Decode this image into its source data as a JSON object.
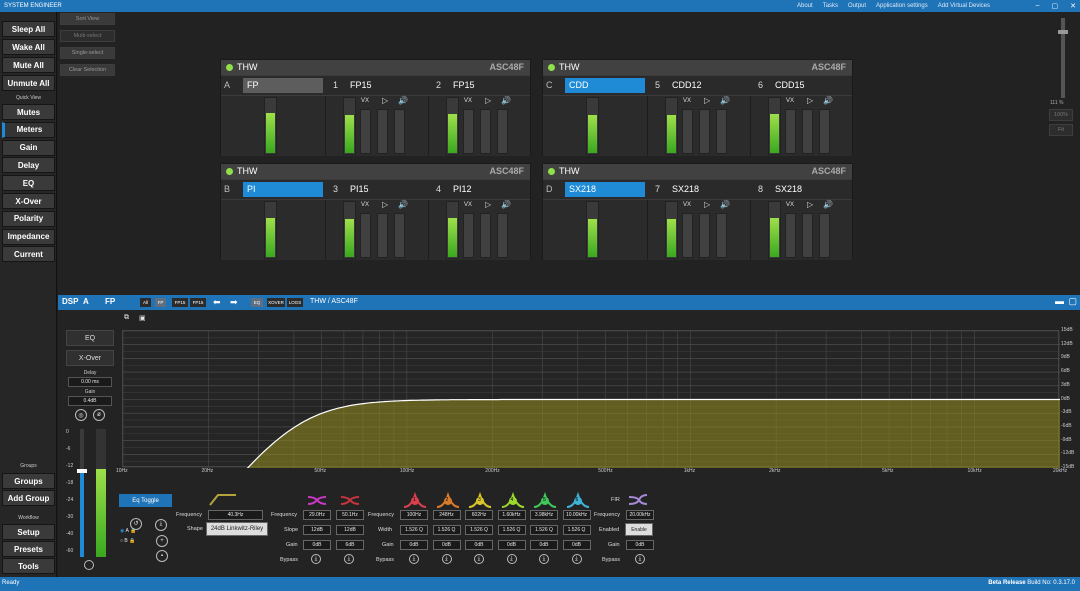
{
  "title": "SYSTEM ENGINEER",
  "menu": [
    "About",
    "Tasks",
    "Output",
    "Application settings",
    "Add Virtual Devices"
  ],
  "sidebar": {
    "top": [
      "Sleep All",
      "Wake All",
      "Mute All",
      "Unmute All"
    ],
    "quick_view_label": "Quick View",
    "quick": [
      "Mutes",
      "Meters",
      "Gain",
      "Delay",
      "EQ",
      "X-Over",
      "Polarity",
      "Impedance",
      "Current"
    ],
    "groups_label": "Groups",
    "groups": [
      "Groups",
      "Add Group"
    ],
    "workflow_label": "Workflow",
    "workflow": [
      "Setup",
      "Presets",
      "Tools"
    ]
  },
  "select": [
    "Sort View",
    "Multi-select",
    "Single-select",
    "Clear Selection"
  ],
  "right": {
    "pct": "111 %",
    "b1": "100%",
    "b2": "Fit"
  },
  "cards": [
    {
      "name": "THW",
      "model": "ASC48F",
      "letter": "A",
      "label": "FP",
      "chs": [
        {
          "n": "1",
          "l": "FP15"
        },
        {
          "n": "2",
          "l": "FP15"
        }
      ]
    },
    {
      "name": "THW",
      "model": "ASC48F",
      "letter": "C",
      "label": "CDD",
      "chs": [
        {
          "n": "5",
          "l": "CDD12"
        },
        {
          "n": "6",
          "l": "CDD15"
        }
      ]
    },
    {
      "name": "THW",
      "model": "ASC48F",
      "letter": "B",
      "label": "PI",
      "chs": [
        {
          "n": "3",
          "l": "PI15"
        },
        {
          "n": "4",
          "l": "PI12"
        }
      ]
    },
    {
      "name": "THW",
      "model": "ASC48F",
      "letter": "D",
      "label": "SX218",
      "chs": [
        {
          "n": "7",
          "l": "SX218"
        },
        {
          "n": "8",
          "l": "SX218"
        }
      ]
    }
  ],
  "vx": "VX",
  "dsp": {
    "label": "DSP",
    "ch": "A",
    "name": "FP",
    "mini": [
      "All",
      "FP",
      "FP15",
      "FP15"
    ],
    "mini2": [
      "EQ",
      "XOVER",
      "LOGS"
    ],
    "crumb": "THW / ASC48F",
    "eq": "EQ",
    "xover": "X-Over",
    "delay_label": "Delay",
    "delay": "0.00 ms",
    "gain_label": "Gain",
    "gain": "0.4dB",
    "eq_toggle": "Eq Toggle",
    "hp": {
      "freq_label": "Frequency",
      "freq": "40.3Hz",
      "shape_label": "Shape",
      "shape": "24dB Linkwitz-Riley"
    },
    "shelf": {
      "freq_label": "Frequency",
      "slope_label": "Slope",
      "gain_label": "Gain",
      "bypass_label": "Bypass",
      "a": {
        "f": "29.0Hz",
        "s": "12dB",
        "g": "0dB"
      },
      "b": {
        "f": "50.1Hz",
        "s": "12dB",
        "g": "6dB"
      }
    },
    "peq": {
      "freq_label": "Frequency",
      "width_label": "Width",
      "gain_label": "Gain",
      "bypass_label": "Bypass",
      "bands": [
        {
          "n": "1",
          "f": "100Hz",
          "w": "1.526 Q",
          "g": "0dB",
          "c": "#d8404b"
        },
        {
          "n": "2",
          "f": "248Hz",
          "w": "1.526 Q",
          "g": "0dB",
          "c": "#d87a2b"
        },
        {
          "n": "3",
          "f": "602Hz",
          "w": "1.526 Q",
          "g": "0dB",
          "c": "#d8c52b"
        },
        {
          "n": "4",
          "f": "1.60kHz",
          "w": "1.526 Q",
          "g": "0dB",
          "c": "#9ad82b"
        },
        {
          "n": "5",
          "f": "3.98kHz",
          "w": "1.526 Q",
          "g": "0dB",
          "c": "#3fc75a"
        },
        {
          "n": "6",
          "f": "10.00kHz",
          "w": "1.526 Q",
          "g": "0dB",
          "c": "#3fb2d8"
        }
      ]
    },
    "fir": {
      "label": "FIR",
      "freq_label": "Frequency",
      "freq": "20.00kHz",
      "enabled_label": "Enabled",
      "enable": "Enable",
      "gain_label": "Gain",
      "gain": "0dB"
    },
    "ab": [
      "A",
      "B"
    ]
  },
  "graph": {
    "ylabels": [
      "15dB",
      "12dB",
      "9dB",
      "6dB",
      "3dB",
      "0dB",
      "-3dB",
      "-6dB",
      "-9dB",
      "-12dB",
      "-15dB"
    ],
    "xlabels": [
      {
        "t": "10Hz",
        "f": 10
      },
      {
        "t": "20Hz",
        "f": 20
      },
      {
        "t": "50Hz",
        "f": 50
      },
      {
        "t": "100Hz",
        "f": 100
      },
      {
        "t": "200Hz",
        "f": 200
      },
      {
        "t": "500Hz",
        "f": 500
      },
      {
        "t": "1kHz",
        "f": 1000
      },
      {
        "t": "2kHz",
        "f": 2000
      },
      {
        "t": "5kHz",
        "f": 5000
      },
      {
        "t": "10kHz",
        "f": 10000
      },
      {
        "t": "20kHz",
        "f": 20000
      }
    ],
    "hp_freq": 40.3
  },
  "meter_scale": [
    "0",
    "-6",
    "-12",
    "-18",
    "-24",
    "-30",
    "-40",
    "-60"
  ],
  "levels": [
    0.72,
    0.68,
    0.7,
    0.68,
    0.68,
    0.7,
    0.7,
    0.68,
    0.7,
    0.68,
    0.68,
    0.7
  ],
  "status": {
    "left": "Ready",
    "beta": "Beta Release",
    "build": "Build No: 0.3.17.0"
  }
}
